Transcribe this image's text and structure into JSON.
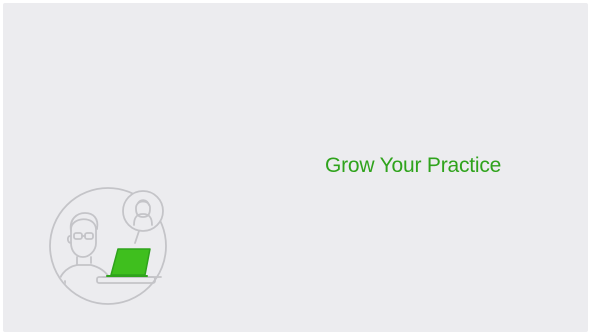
{
  "card": {
    "headline": "Grow Your Practice",
    "illustration": "telehealth-consultation-icon"
  },
  "colors": {
    "background": "#ececef",
    "accent": "#2fa31c",
    "line": "#c4c4c8"
  }
}
